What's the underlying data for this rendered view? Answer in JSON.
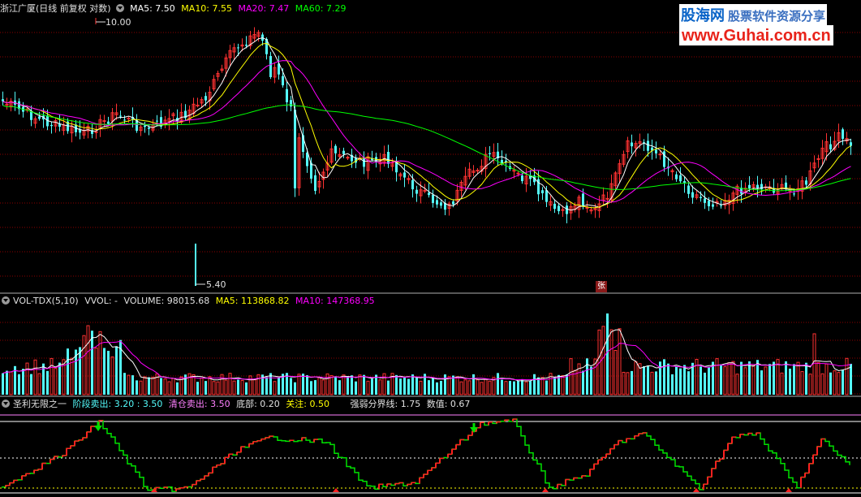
{
  "price_panel": {
    "legend": {
      "title": "浙江广厦(日线 前复权 对数)",
      "ma5": "MA5: 7.50",
      "ma10": "MA10: 7.55",
      "ma20": "MA20: 7.47",
      "ma60": "MA60: 7.29"
    },
    "high_label": "10.00",
    "low_label": "5.40",
    "zhang_label": "张"
  },
  "volume_panel": {
    "legend": {
      "title": "VOL-TDX(5,10)",
      "vvol": "VVOL: -",
      "volume": "VOLUME: 98015.68",
      "ma5": "MA5: 113868.82",
      "ma10": "MA10: 147368.95"
    }
  },
  "indicator_panel": {
    "legend": {
      "title": "圣利无限之一",
      "stage_sell": "阶段卖出: 3.20 : 3.50",
      "clear_sell": "清仓卖出: 3.50",
      "bottom": "底部: 0.20",
      "watch": "关注: 0.50",
      "strength_line": "强弱分界线: 1.75",
      "value": "数值: 0.67"
    }
  },
  "watermark": {
    "logo": "股海网",
    "slogan": "股票软件资源分享",
    "url": "www.Guhai.com.cn"
  },
  "colors": {
    "up": "#ff3232",
    "down": "#54fcfc",
    "ma5": "#ffffff",
    "ma10": "#ffff00",
    "ma20": "#ff00ff",
    "ma60": "#00ff00",
    "grid": "#8b0000",
    "indicator_green": "#00e000",
    "indicator_red": "#ff2020"
  },
  "chart_data": {
    "type": "candlestick",
    "price_range": [
      5.4,
      10.0
    ],
    "scale": "log"
  }
}
